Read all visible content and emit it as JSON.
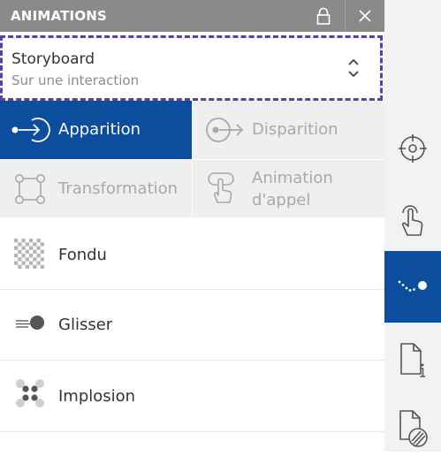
{
  "header": {
    "title": "ANIMATIONS",
    "lock_icon": "lock-icon",
    "close_icon": "close-icon",
    "background_color": "#8a8a8a"
  },
  "trigger": {
    "title": "Storyboard",
    "subtitle": "Sur une interaction",
    "icon": "chevron-up-down-icon",
    "outline_color": "#5b3fa8"
  },
  "tabs": [
    {
      "label": "Apparition",
      "icon": "enter-arrow-icon",
      "selected": true
    },
    {
      "label": "Disparition",
      "icon": "exit-arrow-icon",
      "selected": false
    },
    {
      "label": "Transformation",
      "icon": "transform-nodes-icon",
      "selected": false
    },
    {
      "label_line1": "Animation",
      "label_line2": "d'appel",
      "icon": "pointer-hand-icon",
      "selected": false
    }
  ],
  "effects": [
    {
      "label": "Fondu",
      "icon": "checkerboard-fade-icon"
    },
    {
      "label": "Glisser",
      "icon": "slide-ball-icon"
    },
    {
      "label": "Implosion",
      "icon": "implosion-dots-icon"
    }
  ],
  "sidebar": [
    {
      "name": "target",
      "icon": "target-crosshair-icon",
      "active": false
    },
    {
      "name": "interactions",
      "icon": "touch-hand-icon",
      "active": false
    },
    {
      "name": "animations",
      "icon": "animation-path-icon",
      "active": true
    },
    {
      "name": "page-info",
      "icon": "page-info-icon",
      "active": false
    },
    {
      "name": "master-page",
      "icon": "page-master-icon",
      "active": false
    }
  ],
  "colors": {
    "accent": "#0c4d9e",
    "tab_inactive_bg": "#efefef",
    "tab_inactive_text": "#a9a9a9",
    "sidebar_bg": "#f2f2f2"
  }
}
